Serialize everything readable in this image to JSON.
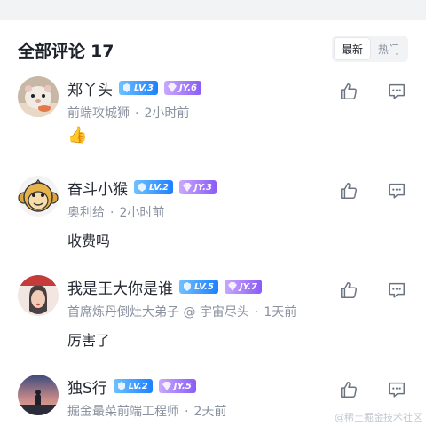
{
  "header": {
    "title": "全部评论",
    "count": "17",
    "sort_options": [
      {
        "label": "最新",
        "active": true
      },
      {
        "label": "热门",
        "active": false
      }
    ]
  },
  "comments": [
    {
      "name": "郑丫头",
      "level": "LV.3",
      "jy": "JY.6",
      "meta_parts": [
        "前端攻城狮",
        "2小时前"
      ],
      "content_emoji": "👍",
      "content": "",
      "avatar": "hamster-avatar"
    },
    {
      "name": "奋斗小猴",
      "level": "LV.2",
      "jy": "JY.3",
      "meta_parts": [
        "奥利给",
        "2小时前"
      ],
      "content": "收费吗",
      "avatar": "monkey-avatar"
    },
    {
      "name": "我是王大你是谁",
      "level": "LV.5",
      "jy": "JY.7",
      "meta_parts": [
        "首席炼丹倒灶大弟子 @ 宇宙尽头",
        "1天前"
      ],
      "content": "厉害了",
      "avatar": "person-avatar"
    },
    {
      "name": "独S行",
      "level": "LV.2",
      "jy": "JY.5",
      "meta_parts": [
        "掘金最菜前端工程师",
        "2天前"
      ],
      "content": "",
      "avatar": "sunset-avatar"
    }
  ],
  "watermark": "@稀土掘金技术社区",
  "colors": {
    "level_badge": "#1e80ff",
    "jy_badge": "#8a5cf5",
    "meta_text": "#8a919f"
  }
}
